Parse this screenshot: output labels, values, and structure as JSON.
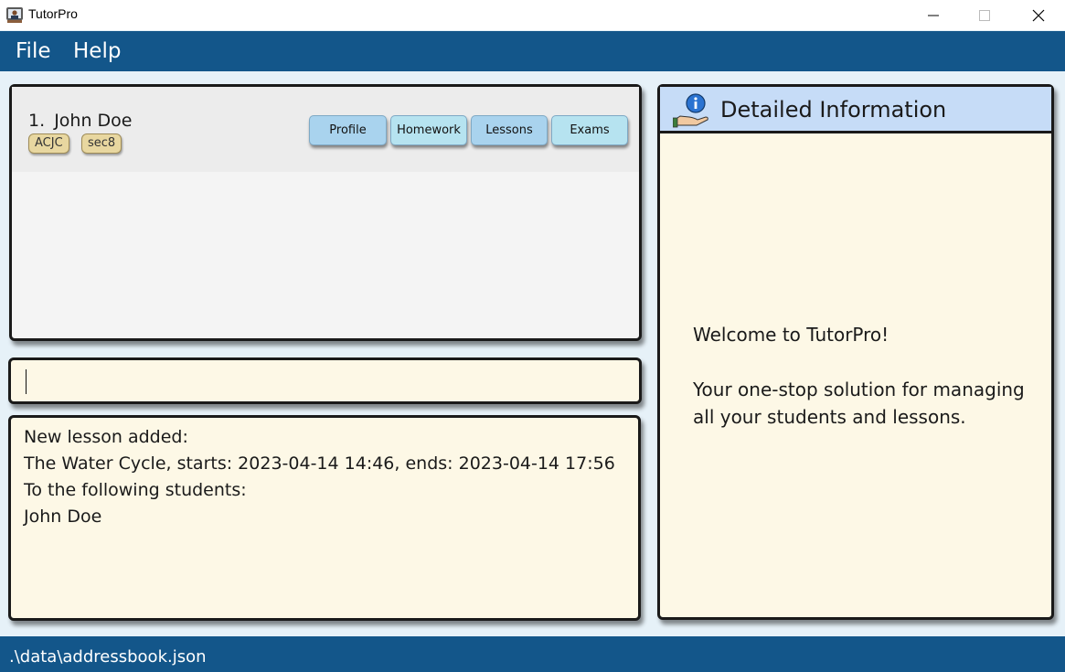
{
  "window": {
    "title": "TutorPro",
    "icon": "tutor-app-icon"
  },
  "menu": {
    "items": [
      "File",
      "Help"
    ]
  },
  "person_list": {
    "persons": [
      {
        "index": "1.",
        "name": "John Doe",
        "tags": [
          "ACJC",
          "sec8"
        ],
        "buttons": [
          "Profile",
          "Homework",
          "Lessons",
          "Exams"
        ]
      }
    ]
  },
  "command_box": {
    "value": ""
  },
  "result_display": {
    "lines": [
      "New lesson added:",
      "The Water Cycle, starts: 2023-04-14 14:46, ends: 2023-04-14 17:56",
      "To the following students:",
      "John Doe"
    ]
  },
  "detail_panel": {
    "title": "Detailed Information",
    "icon": "info-hand-icon",
    "welcome_lines": [
      "Welcome to TutorPro!",
      "",
      "Your one-stop solution for managing",
      "all your students and lessons."
    ]
  },
  "status_bar": {
    "path": ".\\data\\addressbook.json"
  },
  "colors": {
    "accent": "#13568a",
    "panel_bg": "#fdf8e6",
    "header_bg": "#c6dcf7",
    "tag_bg": "#e8d7a0",
    "button_profile": "#a9d3ee",
    "button_homework": "#b6e3f0"
  }
}
